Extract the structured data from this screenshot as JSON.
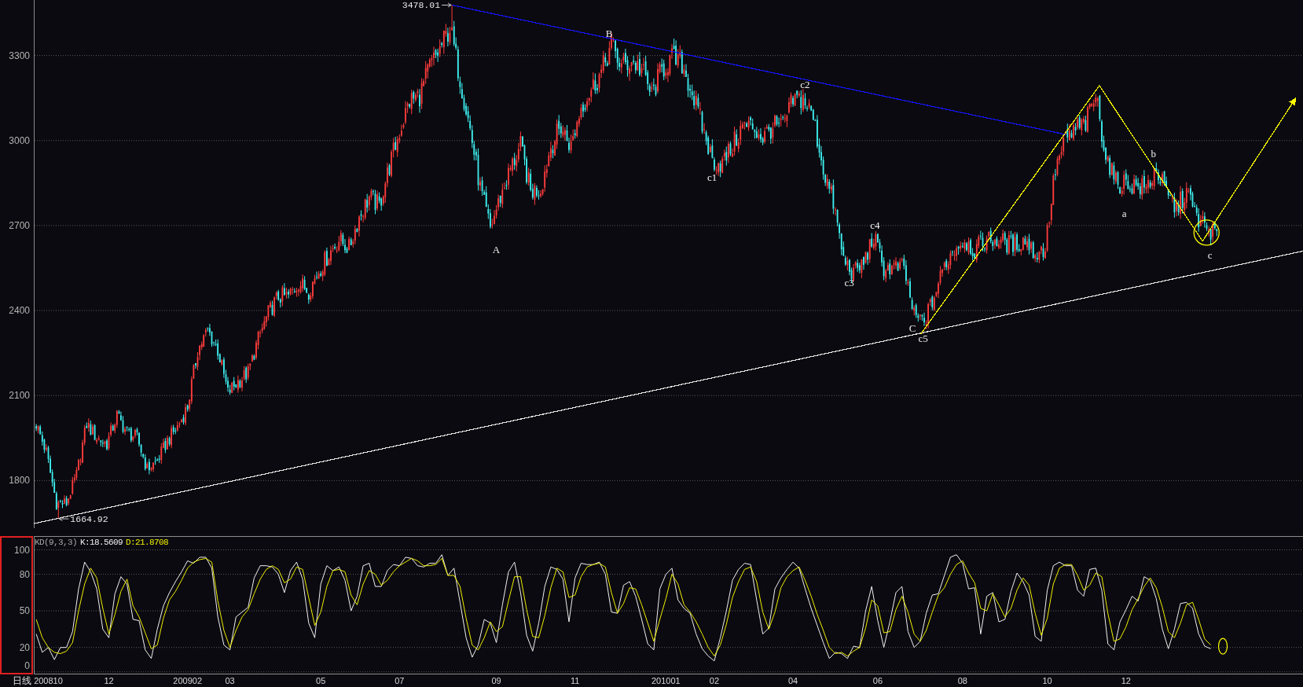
{
  "price_panel": {
    "kind": "candlestick",
    "axis_labels": [
      "3300",
      "3000",
      "2700",
      "2400",
      "2100",
      "1800"
    ],
    "extreme_labels": [
      {
        "kind": "high",
        "text": "3478.01"
      },
      {
        "kind": "low",
        "text": "1664.92"
      }
    ],
    "wave_labels": [
      "A",
      "B",
      "c1",
      "c2",
      "c3",
      "c4",
      "C",
      "c5",
      "a",
      "b",
      "c"
    ],
    "drawings": [
      {
        "kind": "trend-line",
        "color": "#1414ff"
      },
      {
        "kind": "trend-line",
        "color": "#e6e6e6"
      },
      {
        "kind": "projection-arrow",
        "color": "#ffff00"
      },
      {
        "kind": "highlight-circle",
        "color": "#ffff00"
      }
    ]
  },
  "kd_panel": {
    "selected": true,
    "title": "KD(9,3,3)",
    "legend": [
      "K:18.5609",
      "D:21.8708"
    ],
    "drawings": [
      {
        "kind": "highlight-ellipse",
        "color": "#ffff00"
      }
    ],
    "chart_data": {
      "type": "line",
      "grid": true,
      "xlabel": "日线",
      "ylim": [
        -2.1,
        111.3
      ],
      "yticks": [
        0,
        20,
        50,
        80,
        100
      ],
      "categories": [
        null,
        null,
        "200810",
        null,
        null,
        null,
        null,
        null,
        null,
        null,
        null,
        null,
        "12",
        null,
        null,
        null,
        null,
        null,
        null,
        null,
        null,
        null,
        null,
        null,
        null,
        "200902",
        null,
        null,
        null,
        null,
        null,
        null,
        "03",
        null,
        null,
        null,
        null,
        null,
        null,
        null,
        null,
        null,
        null,
        null,
        null,
        null,
        null,
        "05",
        null,
        null,
        null,
        null,
        null,
        null,
        null,
        null,
        null,
        null,
        null,
        null,
        "07",
        null,
        null,
        null,
        null,
        null,
        null,
        null,
        null,
        null,
        null,
        null,
        null,
        null,
        null,
        null,
        "09",
        null,
        null,
        null,
        null,
        null,
        null,
        null,
        null,
        null,
        null,
        null,
        null,
        "11",
        null,
        null,
        null,
        null,
        null,
        null,
        null,
        null,
        null,
        null,
        null,
        null,
        null,
        null,
        "201001",
        null,
        null,
        null,
        null,
        null,
        null,
        null,
        "02",
        null,
        null,
        null,
        null,
        null,
        null,
        null,
        null,
        null,
        null,
        null,
        null,
        "04",
        null,
        null,
        null,
        null,
        null,
        null,
        null,
        null,
        null,
        null,
        null,
        null,
        null,
        "06",
        null,
        null,
        null,
        null,
        null,
        null,
        null,
        null,
        null,
        null,
        null,
        null,
        null,
        "08",
        null,
        null,
        null,
        null,
        null,
        null,
        null,
        null,
        null,
        null,
        null,
        null,
        null,
        "10",
        null,
        null,
        null,
        null,
        null,
        null,
        null,
        null,
        null,
        null,
        null,
        null,
        "12",
        null,
        null,
        null,
        null,
        null,
        null,
        null,
        null,
        null,
        null,
        null,
        null,
        null,
        null
      ],
      "series": [
        {
          "color": "#f0f0f0",
          "values": [
            31,
            16,
            20,
            10,
            20,
            20,
            33,
            68,
            90,
            82,
            68,
            35,
            28,
            64,
            78,
            72,
            43,
            42,
            18,
            11,
            35,
            54,
            65,
            74,
            82,
            91,
            89,
            94,
            94,
            85,
            45,
            22,
            18,
            45,
            49,
            53,
            77,
            87,
            87,
            86,
            80,
            65,
            83,
            90,
            76,
            40,
            28,
            72,
            87,
            83,
            86,
            75,
            50,
            62,
            87,
            89,
            70,
            70,
            83,
            88,
            87,
            94,
            93,
            87,
            86,
            89,
            89,
            96,
            79,
            85,
            57,
            28,
            12,
            22,
            43,
            40,
            24,
            55,
            82,
            90,
            65,
            30,
            17,
            40,
            70,
            86,
            84,
            76,
            41,
            77,
            89,
            88,
            88,
            90,
            80,
            49,
            48,
            71,
            74,
            62,
            43,
            23,
            18,
            68,
            80,
            85,
            59,
            52,
            48,
            31,
            19,
            13,
            9,
            28,
            50,
            75,
            84,
            89,
            88,
            59,
            31,
            36,
            68,
            77,
            84,
            90,
            85,
            68,
            52,
            38,
            24,
            11,
            16,
            15,
            11,
            21,
            20,
            50,
            70,
            42,
            20,
            41,
            65,
            70,
            33,
            20,
            25,
            48,
            63,
            64,
            79,
            94,
            96,
            89,
            68,
            69,
            31,
            62,
            65,
            41,
            43,
            66,
            81,
            74,
            63,
            29,
            25,
            67,
            87,
            90,
            87,
            87,
            67,
            62,
            84,
            85,
            67,
            23,
            18,
            41,
            51,
            62,
            58,
            78,
            75,
            60,
            35,
            19,
            35,
            56,
            57,
            52,
            31,
            21,
            19
          ]
        },
        {
          "color": "#f0f000",
          "values": [
            43,
            28,
            20,
            16,
            15,
            17,
            24,
            50,
            72,
            85,
            77,
            52,
            31,
            47,
            66,
            76,
            54,
            45,
            32,
            19,
            22,
            44,
            59,
            66,
            75,
            85,
            90,
            92,
            93,
            90,
            58,
            34,
            20,
            34,
            45,
            51,
            64,
            76,
            84,
            87,
            84,
            73,
            76,
            86,
            84,
            61,
            38,
            49,
            70,
            83,
            84,
            82,
            63,
            55,
            72,
            83,
            80,
            71,
            75,
            82,
            87,
            90,
            93,
            91,
            87,
            87,
            88,
            93,
            79,
            79,
            70,
            44,
            22,
            18,
            28,
            41,
            33,
            37,
            58,
            78,
            78,
            51,
            29,
            28,
            46,
            69,
            85,
            82,
            61,
            63,
            78,
            86,
            88,
            89,
            86,
            65,
            48,
            56,
            69,
            68,
            55,
            40,
            25,
            43,
            60,
            80,
            72,
            55,
            49,
            41,
            31,
            20,
            13,
            22,
            39,
            61,
            74,
            84,
            86,
            74,
            49,
            35,
            49,
            69,
            78,
            83,
            86,
            75,
            62,
            47,
            34,
            20,
            15,
            16,
            13,
            17,
            20,
            36,
            59,
            54,
            32,
            33,
            51,
            62,
            49,
            31,
            25,
            34,
            49,
            63,
            69,
            80,
            88,
            91,
            81,
            73,
            52,
            50,
            64,
            55,
            45,
            52,
            67,
            77,
            71,
            48,
            30,
            44,
            72,
            85,
            88,
            88,
            79,
            67,
            71,
            81,
            78,
            48,
            25,
            27,
            37,
            51,
            60,
            70,
            77,
            69,
            53,
            33,
            28,
            40,
            55,
            57,
            43,
            27,
            22
          ]
        }
      ]
    }
  }
}
